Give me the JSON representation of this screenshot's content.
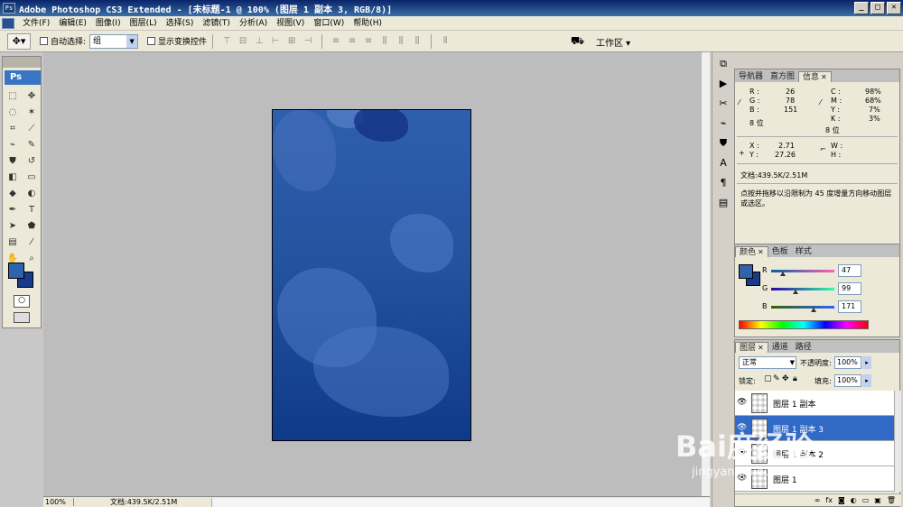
{
  "window": {
    "title": "Adobe Photoshop CS3 Extended - [未标题-1 @ 100% (图层 1 副本 3, RGB/8)]",
    "icon": "ps-app-icon"
  },
  "menu": {
    "items": [
      "文件(F)",
      "编辑(E)",
      "图像(I)",
      "图层(L)",
      "选择(S)",
      "滤镜(T)",
      "分析(A)",
      "视图(V)",
      "窗口(W)",
      "帮助(H)"
    ]
  },
  "options": {
    "auto_select_label": "自动选择:",
    "auto_select_value": "组",
    "show_transform_label": "显示变换控件",
    "workspace_label": "工作区 ▾"
  },
  "toolbox": {
    "logo": "Ps",
    "foreground_color": "#2f63ab",
    "background_color": "#173a8a"
  },
  "status": {
    "zoom": "100%",
    "doc_info": "文档:439.5K/2.51M"
  },
  "info_panel": {
    "tabs": [
      "导航器",
      "直方图",
      "信息"
    ],
    "r_label": "R :",
    "r_value": "26",
    "g_label": "G :",
    "g_value": "78",
    "b_label": "B :",
    "b_value": "151",
    "bit_left": "8 位",
    "c_label": "C :",
    "c_value": "98%",
    "m_label": "M :",
    "m_value": "68%",
    "y_label": "Y :",
    "y_value": "7%",
    "k_label": "K :",
    "k_value": "3%",
    "bit_right": "8 位",
    "x_label": "X :",
    "x_value": "2.71",
    "y2_label": "Y :",
    "y2_value": "27.26",
    "w_label": "W :",
    "h_label": "H :",
    "doc_info": "文档:439.5K/2.51M",
    "hint": "点按并拖移以沿限制为 45 度增量方向移动图层或选区。"
  },
  "color_panel": {
    "tabs": [
      "颜色",
      "色板",
      "样式"
    ],
    "r_label": "R",
    "r_value": "47",
    "g_label": "G",
    "g_value": "99",
    "b_label": "B",
    "b_value": "171"
  },
  "layers_panel": {
    "tabs": [
      "图层",
      "通道",
      "路径"
    ],
    "blend_mode": "正常",
    "opacity_label": "不透明度:",
    "opacity_value": "100%",
    "lock_label": "锁定:",
    "fill_label": "填充:",
    "fill_value": "100%",
    "layers": [
      {
        "name": "图层 1 副本",
        "selected": false
      },
      {
        "name": "图层 1 副本 3",
        "selected": true
      },
      {
        "name": "图层 1 副本 2",
        "selected": false
      },
      {
        "name": "图层 1",
        "selected": false
      }
    ]
  },
  "watermark": {
    "line1": "Bai度经验",
    "line2": "jingyan.baidu.com"
  }
}
